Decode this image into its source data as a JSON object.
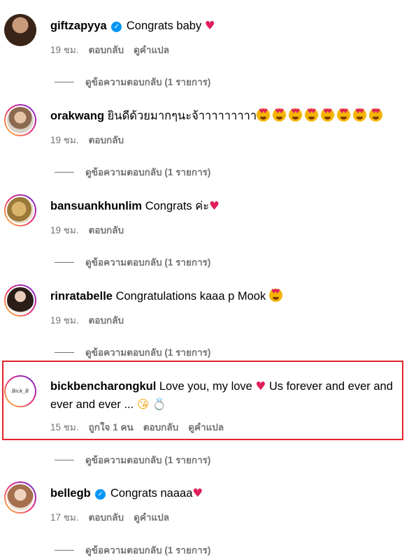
{
  "comments": [
    {
      "username": "giftzapyya",
      "text": "Congrats baby",
      "time": "19 ชม.",
      "reply": "ตอบกลับ",
      "translate": "ดูคำแปล",
      "view_replies": "ดูข้อความตอบกลับ (1 รายการ)"
    },
    {
      "username": "orakwang",
      "text": "ยินดีด้วยมากๆนะจ้าาาาาาาาา",
      "time": "19 ชม.",
      "reply": "ตอบกลับ",
      "view_replies": "ดูข้อความตอบกลับ (1 รายการ)"
    },
    {
      "username": "bansuankhunlim",
      "text": "Congrats ค่ะ",
      "time": "19 ชม.",
      "reply": "ตอบกลับ",
      "view_replies": "ดูข้อความตอบกลับ (1 รายการ)"
    },
    {
      "username": "rinratabelle",
      "text": "Congratulations kaaa p Mook",
      "time": "19 ชม.",
      "reply": "ตอบกลับ",
      "view_replies": "ดูข้อความตอบกลับ (1 รายการ)"
    },
    {
      "username": "bickbencharongkul",
      "text_a": "Love you, my love",
      "text_b": "Us forever and ever",
      "text_c": "and ever and ever ...",
      "time": "15 ชม.",
      "likes": "ถูกใจ 1 คน",
      "reply": "ตอบกลับ",
      "translate": "ดูคำแปล",
      "view_replies": "ดูข้อความตอบกลับ (1 รายการ)",
      "avatar_text": "Bick_B"
    },
    {
      "username": "bellegb",
      "text": "Congrats naaaa",
      "time": "17 ชม.",
      "reply": "ตอบกลับ",
      "translate": "ดูคำแปล",
      "view_replies": "ดูข้อความตอบกลับ (1 รายการ)"
    }
  ],
  "colors": {
    "verified": "#0095f6",
    "heart": "#e11d5a",
    "highlight_border": "#e0232b",
    "muted_text": "#737373"
  },
  "icons": [
    "verified-badge-icon",
    "heart-emoji-icon",
    "heart-eyes-emoji-icon",
    "kiss-emoji-icon",
    "ring-emoji-icon"
  ]
}
